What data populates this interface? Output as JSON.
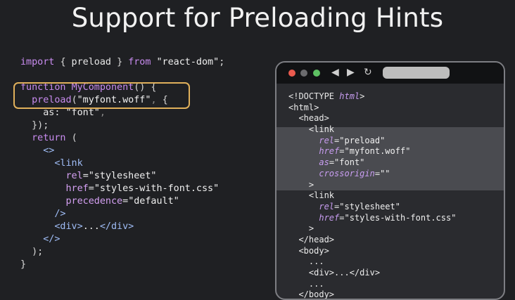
{
  "slide": {
    "title": "Support for Preloading Hints"
  },
  "code_left": {
    "lines": [
      "import { preload } from \"react-dom\";",
      "",
      "function MyComponent() {",
      "  preload(\"myfont.woff\", {",
      "    as: \"font\",",
      "  });",
      "  return (",
      "    <>",
      "      <link",
      "        rel=\"stylesheet\"",
      "        href=\"styles-with-font.css\"",
      "        precedence=\"default\"",
      "      />",
      "      <div>...</div>",
      "    </>",
      "  );",
      "}"
    ]
  },
  "browser": {
    "icons": [
      "back-arrow-icon",
      "forward-arrow-icon",
      "reload-icon"
    ],
    "code_lines": [
      "<!DOCTYPE html>",
      "<html>",
      "  <head>",
      "    <link",
      "      rel=\"preload\"",
      "      href=\"myfont.woff\"",
      "      as=\"font\"",
      "      crossorigin=\"\"",
      "    >",
      "    <link",
      "      rel=\"stylesheet\"",
      "      href=\"styles-with-font.css\"",
      "    >",
      "  </head>",
      "  <body>",
      "    ...",
      "    <div>...</div>",
      "    ...",
      "  </body>"
    ]
  },
  "colors": {
    "background": "#1f2023",
    "keyword": "#c98cf0",
    "highlight_border": "#e0b05b",
    "browser_frame": "#7d7e83",
    "highlight_band": "#4a4b50"
  }
}
